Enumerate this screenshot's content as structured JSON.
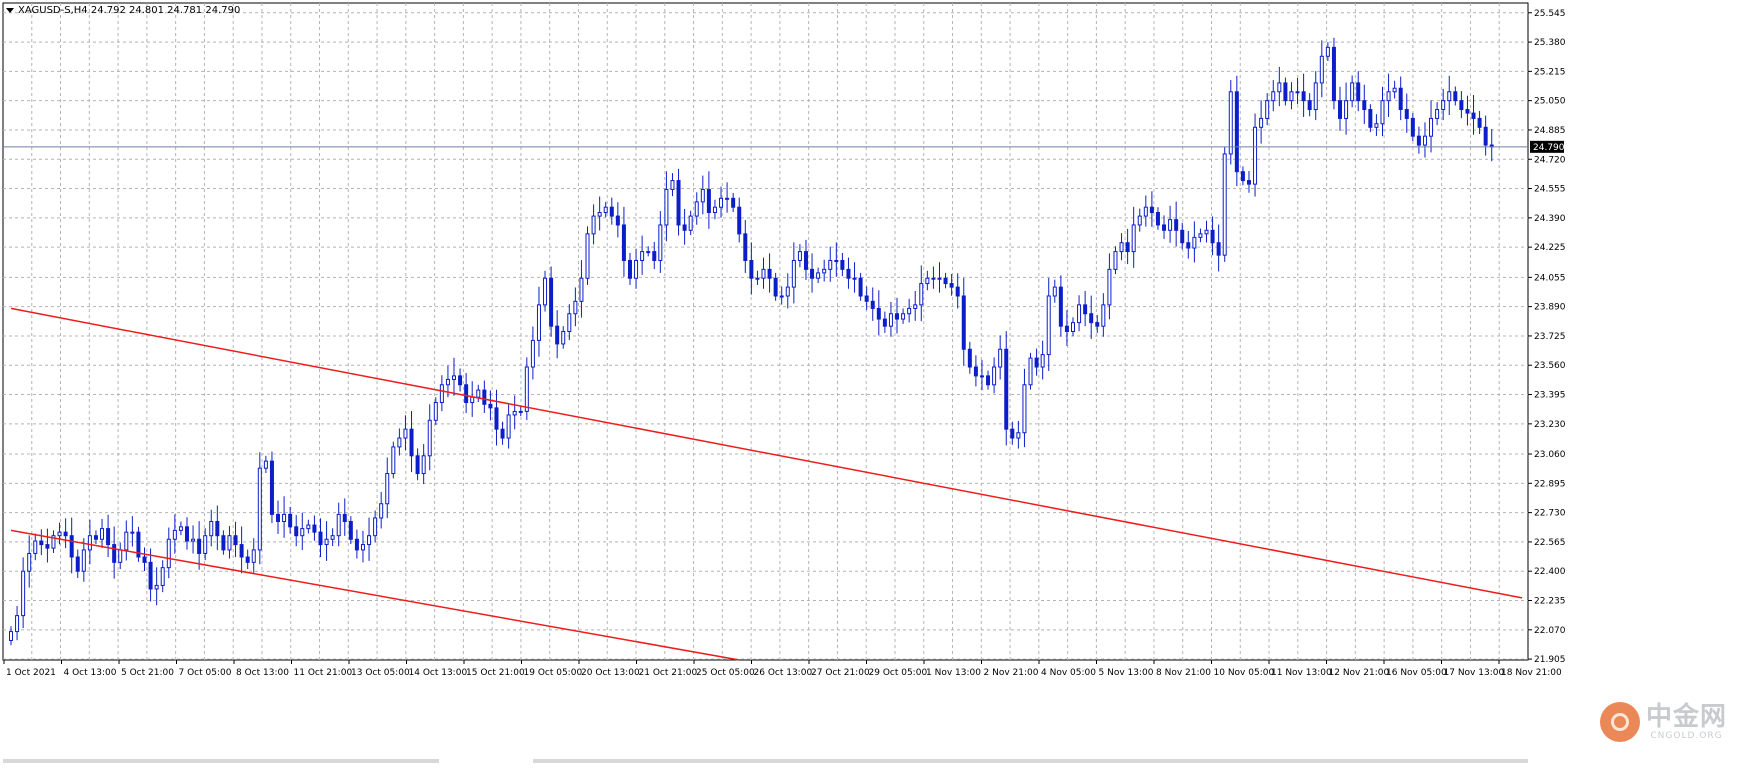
{
  "symbol": {
    "text": "XAGUSD-S,H4  24.792 24.801 24.781 24.790"
  },
  "watermark": {
    "cn": "中金网",
    "en": "CNGOLD.ORG"
  },
  "colors": {
    "candle": "#0c1ec8",
    "trendline": "#ee1c1c",
    "grid": "#b4b4b4",
    "current_price_line": "#6b7fa8"
  },
  "chart_data": {
    "type": "candlestick",
    "title": "",
    "ylim": [
      21.9,
      25.6
    ],
    "current_price": 24.79,
    "current_price_label": "24.790",
    "y_ticks": [
      "25.545",
      "25.380",
      "25.215",
      "25.050",
      "24.885",
      "24.720",
      "24.555",
      "24.390",
      "24.225",
      "24.055",
      "23.890",
      "23.725",
      "23.560",
      "23.395",
      "23.230",
      "23.060",
      "22.895",
      "22.730",
      "22.565",
      "22.400",
      "22.235",
      "22.070",
      "21.905"
    ],
    "x_labels": [
      "1 Oct 2021",
      "4 Oct 13:00",
      "5 Oct 21:00",
      "7 Oct 05:00",
      "8 Oct 13:00",
      "11 Oct 21:00",
      "13 Oct 05:00",
      "14 Oct 13:00",
      "15 Oct 21:00",
      "19 Oct 05:00",
      "20 Oct 13:00",
      "21 Oct 21:00",
      "25 Oct 05:00",
      "26 Oct 13:00",
      "27 Oct 21:00",
      "29 Oct 05:00",
      "1 Nov 13:00",
      "2 Nov 21:00",
      "4 Nov 05:00",
      "5 Nov 13:00",
      "8 Nov 21:00",
      "10 Nov 05:00",
      "11 Nov 13:00",
      "12 Nov 21:00",
      "16 Nov 05:00",
      "17 Nov 13:00",
      "18 Nov 21:00"
    ],
    "candle_count": 249,
    "closes": [
      22.06,
      22.15,
      22.4,
      22.5,
      22.57,
      22.55,
      22.53,
      22.6,
      22.62,
      22.6,
      22.48,
      22.4,
      22.52,
      22.6,
      22.58,
      22.64,
      22.55,
      22.45,
      22.52,
      22.62,
      22.62,
      22.48,
      22.45,
      22.3,
      22.32,
      22.42,
      22.58,
      22.63,
      22.65,
      22.57,
      22.58,
      22.5,
      22.6,
      22.68,
      22.6,
      22.52,
      22.6,
      22.55,
      22.48,
      22.45,
      22.52,
      22.98,
      23.02,
      22.72,
      22.68,
      22.72,
      22.65,
      22.6,
      22.64,
      22.66,
      22.62,
      22.55,
      22.58,
      22.6,
      22.72,
      22.68,
      22.58,
      22.52,
      22.55,
      22.6,
      22.7,
      22.78,
      22.95,
      23.1,
      23.15,
      23.2,
      23.05,
      22.95,
      23.05,
      23.25,
      23.35,
      23.45,
      23.48,
      23.5,
      23.45,
      23.35,
      23.38,
      23.42,
      23.34,
      23.32,
      23.2,
      23.15,
      23.28,
      23.3,
      23.3,
      23.55,
      23.7,
      23.9,
      24.05,
      23.78,
      23.68,
      23.75,
      23.85,
      23.92,
      24.05,
      24.3,
      24.4,
      24.42,
      24.45,
      24.4,
      24.35,
      24.15,
      24.05,
      24.15,
      24.2,
      24.2,
      24.15,
      24.35,
      24.55,
      24.6,
      24.35,
      24.32,
      24.4,
      24.48,
      24.55,
      24.42,
      24.45,
      24.5,
      24.5,
      24.45,
      24.3,
      24.15,
      24.05,
      24.05,
      24.1,
      24.05,
      23.95,
      23.95,
      24.0,
      24.15,
      24.2,
      24.1,
      24.05,
      24.08,
      24.1,
      24.15,
      24.15,
      24.1,
      24.05,
      24.05,
      23.95,
      23.92,
      23.88,
      23.82,
      23.78,
      23.85,
      23.82,
      23.85,
      23.88,
      23.9,
      24.02,
      24.05,
      24.05,
      24.05,
      24.02,
      24.0,
      23.95,
      23.65,
      23.55,
      23.5,
      23.5,
      23.45,
      23.55,
      23.65,
      23.2,
      23.15,
      23.18,
      23.45,
      23.6,
      23.55,
      23.62,
      23.95,
      24.0,
      23.78,
      23.75,
      23.8,
      23.9,
      23.85,
      23.8,
      23.78,
      23.9,
      24.1,
      24.2,
      24.25,
      24.2,
      24.35,
      24.4,
      24.45,
      24.42,
      24.35,
      24.32,
      24.38,
      24.32,
      24.25,
      24.22,
      24.28,
      24.3,
      24.32,
      24.25,
      24.18,
      24.75,
      25.1,
      24.65,
      24.6,
      24.58,
      24.9,
      24.95,
      25.05,
      25.1,
      25.15,
      25.05,
      25.1,
      25.1,
      25.05,
      25.0,
      25.15,
      25.3,
      25.35,
      25.05,
      24.95,
      25.05,
      25.15,
      25.05,
      25.0,
      24.9,
      24.92,
      25.05,
      25.1,
      25.12,
      25.0,
      24.95,
      24.85,
      24.8,
      24.85,
      24.95,
      25.0,
      25.05,
      25.1,
      25.05,
      25.0,
      24.98,
      24.95,
      24.9,
      24.8,
      24.79
    ],
    "trendlines": [
      {
        "from": {
          "candle": 0,
          "price": 23.88
        },
        "to": {
          "candle": 249,
          "price": 22.25
        }
      },
      {
        "from": {
          "candle": 0,
          "price": 22.63
        },
        "to": {
          "candle": 120,
          "price": 21.9
        }
      }
    ]
  }
}
